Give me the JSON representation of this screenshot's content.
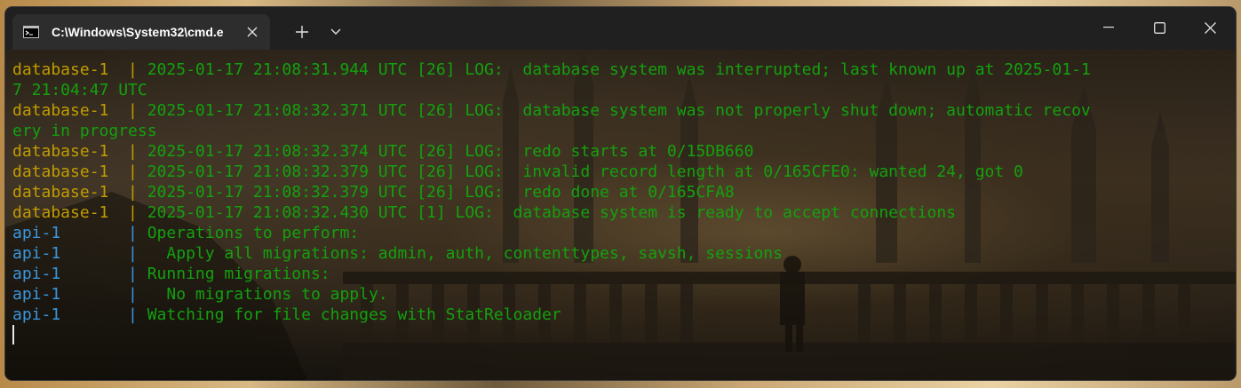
{
  "window": {
    "tab_title": "C:\\Windows\\System32\\cmd.e",
    "tab_icon": "terminal-icon",
    "controls": [
      "new-tab-icon",
      "dropdown-chevron-icon",
      "minimize-icon",
      "maximize-icon",
      "close-icon"
    ]
  },
  "colors": {
    "database_prefix": "#c19c00",
    "api_prefix": "#3a96dd",
    "log_text": "#13a10e"
  },
  "terminal": {
    "lines": [
      {
        "prefix": "database-1  | ",
        "text": "2025-01-17 21:08:31.944 UTC [26] LOG:  database system was interrupted; last known up at 2025-01-1"
      },
      {
        "prefix": "",
        "text": "7 21:04:47 UTC"
      },
      {
        "prefix": "database-1  | ",
        "text": "2025-01-17 21:08:32.371 UTC [26] LOG:  database system was not properly shut down; automatic recov"
      },
      {
        "prefix": "",
        "text": "ery in progress"
      },
      {
        "prefix": "database-1  | ",
        "text": "2025-01-17 21:08:32.374 UTC [26] LOG:  redo starts at 0/15DB660"
      },
      {
        "prefix": "database-1  | ",
        "text": "2025-01-17 21:08:32.379 UTC [26] LOG:  invalid record length at 0/165CFE0: wanted 24, got 0"
      },
      {
        "prefix": "database-1  | ",
        "text": "2025-01-17 21:08:32.379 UTC [26] LOG:  redo done at 0/165CFA8"
      },
      {
        "prefix": "database-1  | ",
        "text": "2025-01-17 21:08:32.430 UTC [1] LOG:  database system is ready to accept connections"
      },
      {
        "prefix": "api-1       | ",
        "text": "Operations to perform:"
      },
      {
        "prefix": "api-1       | ",
        "text": "  Apply all migrations: admin, auth, contenttypes, savsh, sessions"
      },
      {
        "prefix": "api-1       | ",
        "text": "Running migrations:"
      },
      {
        "prefix": "api-1       | ",
        "text": "  No migrations to apply."
      },
      {
        "prefix": "api-1       | ",
        "text": "Watching for file changes with StatReloader"
      }
    ]
  }
}
